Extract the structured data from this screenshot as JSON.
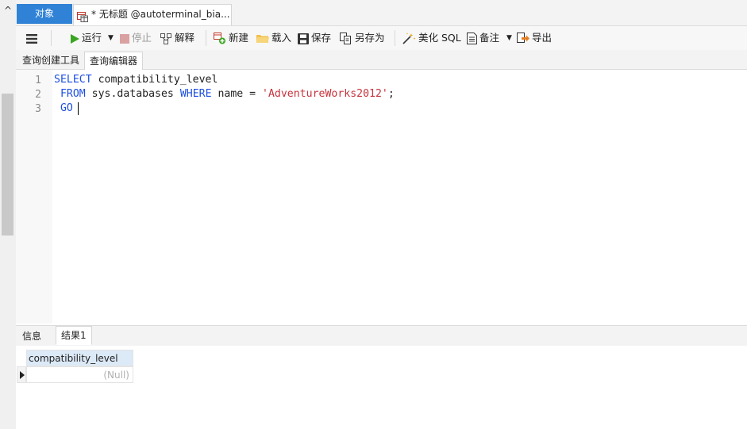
{
  "tabs": {
    "objects_label": "对象",
    "query_label": "* 无标题 @autoterminal_bia..."
  },
  "toolbar": {
    "run_label": "运行",
    "stop_label": "停止",
    "explain_label": "解释",
    "new_label": "新建",
    "load_label": "载入",
    "save_label": "保存",
    "save_as_label": "另存为",
    "beautify_label": "美化 SQL",
    "comment_label": "备注",
    "export_label": "导出"
  },
  "subtabs": {
    "builder_label": "查询创建工具",
    "editor_label": "查询编辑器"
  },
  "editor": {
    "line_numbers": [
      "1",
      "2",
      "3"
    ],
    "line1": {
      "kw1": "SELECT",
      "rest": " compatibility_level"
    },
    "line2": {
      "indent": " ",
      "kw1": "FROM",
      "mid": " sys.databases ",
      "kw2": "WHERE",
      "mid2": " name = ",
      "str": "'AdventureWorks2012'",
      "end": ";"
    },
    "line3": {
      "indent": " ",
      "kw1": "GO"
    }
  },
  "bottom_tabs": {
    "info_label": "信息",
    "result_label": "结果1"
  },
  "result_grid": {
    "columns": [
      "compatibility_level"
    ],
    "rows": [
      [
        "(Null)"
      ]
    ]
  },
  "colors": {
    "accent": "#2f82d6",
    "keyword": "#1c4fe0",
    "string": "#c8323c",
    "header_bg": "#dce9f7"
  }
}
